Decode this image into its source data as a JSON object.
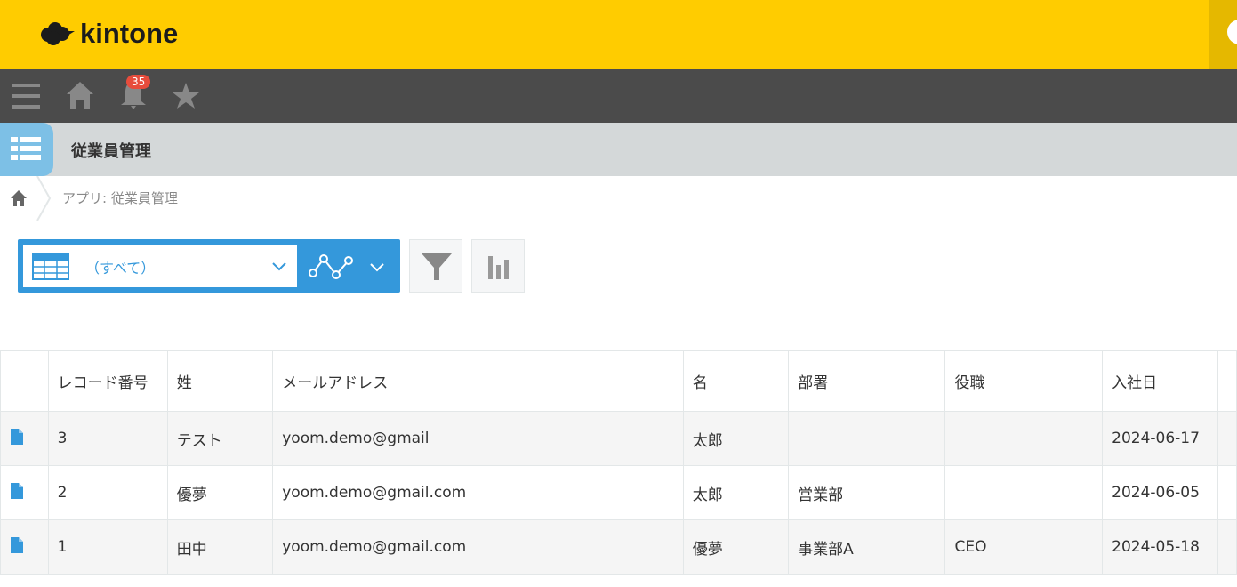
{
  "header": {
    "logo": "kintone"
  },
  "nav": {
    "notification_count": "35"
  },
  "app": {
    "title": "従業員管理",
    "breadcrumb": "アプリ: 従業員管理"
  },
  "view": {
    "selected": "（すべて）"
  },
  "table": {
    "columns": [
      "レコード番号",
      "姓",
      "メールアドレス",
      "名",
      "部署",
      "役職",
      "入社日"
    ],
    "rows": [
      [
        "3",
        "テスト",
        "yoom.demo@gmail",
        "太郎",
        "",
        "",
        "2024-06-17"
      ],
      [
        "2",
        "優夢",
        "yoom.demo@gmail.com",
        "太郎",
        "営業部",
        "",
        "2024-06-05"
      ],
      [
        "1",
        "田中",
        "yoom.demo@gmail.com",
        "優夢",
        "事業部A",
        "CEO",
        "2024-05-18"
      ]
    ]
  },
  "colors": {
    "brand": "#ffcc00",
    "accent": "#3498db"
  }
}
